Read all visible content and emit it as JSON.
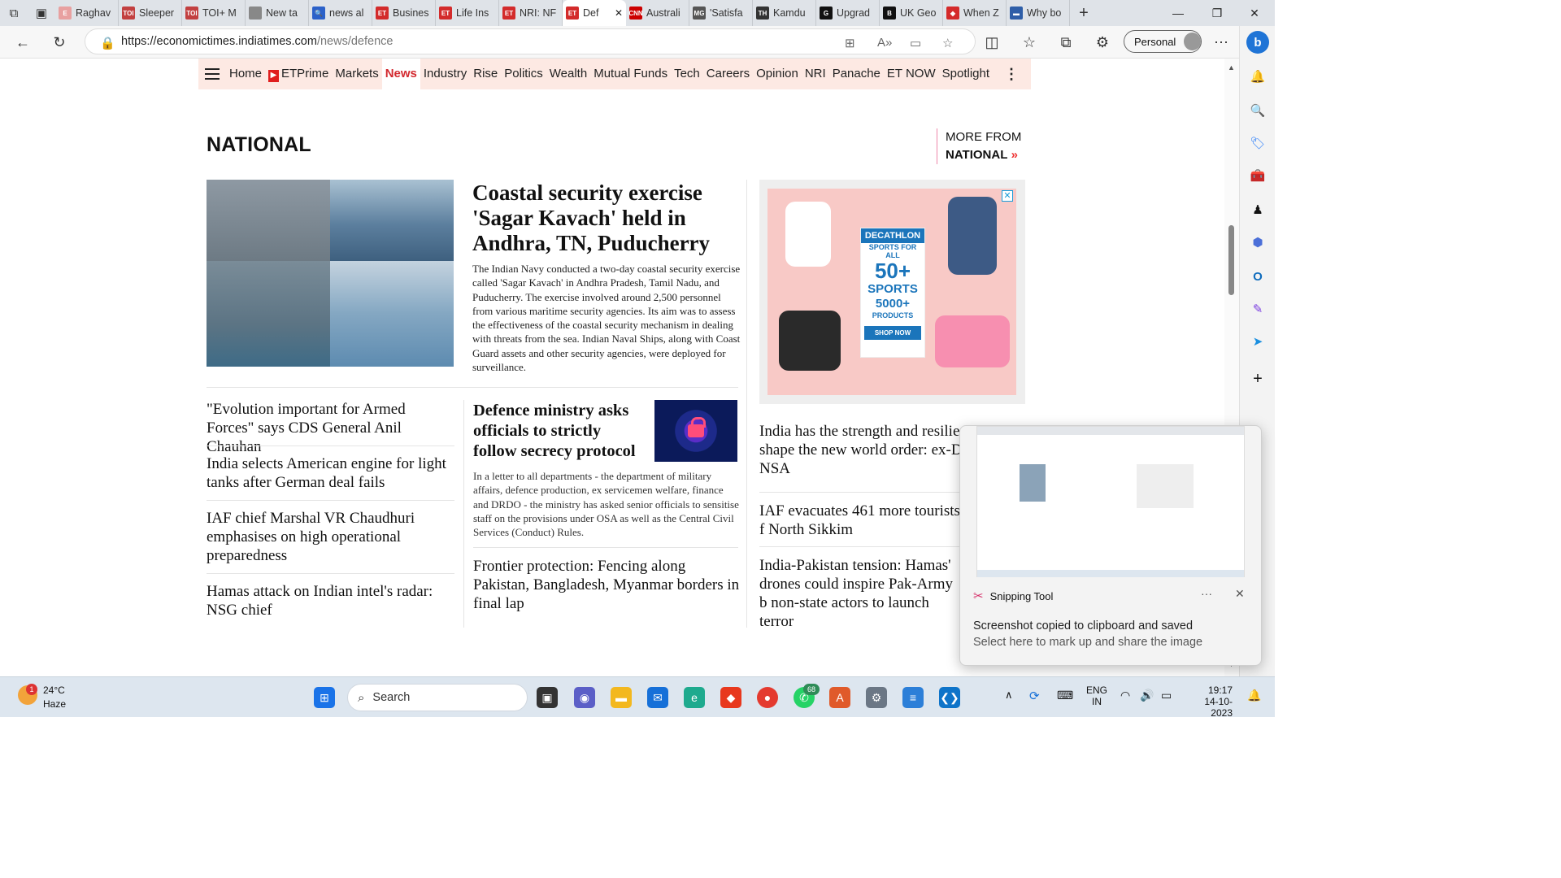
{
  "browser": {
    "tabs": [
      {
        "title": "Raghav",
        "fav": "E",
        "color": "#e8a0a0"
      },
      {
        "title": "Sleeper",
        "fav": "TOI",
        "color": "#c24040"
      },
      {
        "title": "TOI+ M",
        "fav": "TOI",
        "color": "#c24040"
      },
      {
        "title": "New ta",
        "fav": "",
        "color": "#888"
      },
      {
        "title": "news al",
        "fav": "🔍",
        "color": "#2b61c9"
      },
      {
        "title": "Busines",
        "fav": "ET",
        "color": "#d32b2b"
      },
      {
        "title": "Life Ins",
        "fav": "ET",
        "color": "#d32b2b"
      },
      {
        "title": "NRI: NF",
        "fav": "ET",
        "color": "#d32b2b"
      },
      {
        "title": "Def",
        "fav": "ET",
        "color": "#d32b2b"
      },
      {
        "title": "Australi",
        "fav": "CNN",
        "color": "#cc0000"
      },
      {
        "title": "'Satisfa",
        "fav": "MG",
        "color": "#555"
      },
      {
        "title": "Kamdu",
        "fav": "TH",
        "color": "#333"
      },
      {
        "title": "Upgrad",
        "fav": "G",
        "color": "#111"
      },
      {
        "title": "UK Geo",
        "fav": "B",
        "color": "#111"
      },
      {
        "title": "When Z",
        "fav": "◆",
        "color": "#d42a2a"
      },
      {
        "title": "Why bo",
        "fav": "▬",
        "color": "#2e5ea8"
      }
    ],
    "url_host": "https://economictimes.indiatimes.com",
    "url_path": "/news/defence",
    "profile": "Personal"
  },
  "nav": {
    "items": [
      "Home",
      "ETPrime",
      "Markets",
      "News",
      "Industry",
      "Rise",
      "Politics",
      "Wealth",
      "Mutual Funds",
      "Tech",
      "Careers",
      "Opinion",
      "NRI",
      "Panache",
      "ET NOW",
      "Spotlight"
    ],
    "active": "News",
    "more_icon": "more-vertical-icon"
  },
  "section": {
    "title": "NATIONAL",
    "more_label": "MORE FROM",
    "more_link": "NATIONAL"
  },
  "lead": {
    "headline": "Coastal security exercise 'Sagar Kavach' held in Andhra, TN, Puducherry",
    "summary": "The Indian Navy conducted a two-day coastal security exercise called 'Sagar Kavach' in Andhra Pradesh, Tamil Nadu, and Puducherry. The exercise involved around 2,500 personnel from various maritime security agencies. Its aim was to assess the effectiveness of the coastal security mechanism in dealing with threats from the sea. Indian Naval Ships, along with Coast Guard assets and other security agencies, were deployed for surveillance."
  },
  "left_list": [
    "\"Evolution important for Armed Forces\" says CDS General Anil Chauhan",
    "India selects American engine for light tanks after German deal fails",
    "IAF chief Marshal VR Chaudhuri emphasises on high operational preparedness",
    "Hamas attack on Indian intel's radar: NSG chief"
  ],
  "middle": {
    "headline": "Defence ministry asks officials to strictly follow secrecy protocol",
    "summary": "In a letter to all departments - the department of military affairs, defence production, ex servicemen welfare, finance and DRDO - the ministry has asked senior officials to sensitise staff on the provisions under OSA as well as the Central Civil Services (Conduct) Rules.",
    "second": "Frontier protection: Fencing along Pakistan, Bangladesh, Myanmar borders in final lap"
  },
  "ad": {
    "brand": "DECATHLON",
    "tagline": "SPORTS FOR ALL",
    "big": "50+",
    "sports": "SPORTS",
    "products_num": "5000+",
    "products": "PRODUCTS",
    "cta": "SHOP NOW",
    "close": "✕"
  },
  "right_list": [
    "India has the strength and resilie shape the new world order: ex-D NSA",
    "IAF evacuates 461 more tourists f North Sikkim",
    "India-Pakistan tension: Hamas' drones could inspire Pak-Army b non-state actors to launch terror"
  ],
  "snipping": {
    "app": "Snipping Tool",
    "line1": "Screenshot copied to clipboard and saved",
    "line2": "Select here to mark up and share the image",
    "dots": "···",
    "close": "✕"
  },
  "taskbar": {
    "weather_badge": "1",
    "temp": "24°C",
    "condition": "Haze",
    "search": "Search",
    "whatsapp_badge": "68",
    "lang1": "ENG",
    "lang2": "IN",
    "time": "19:17",
    "date": "14-10-2023"
  }
}
